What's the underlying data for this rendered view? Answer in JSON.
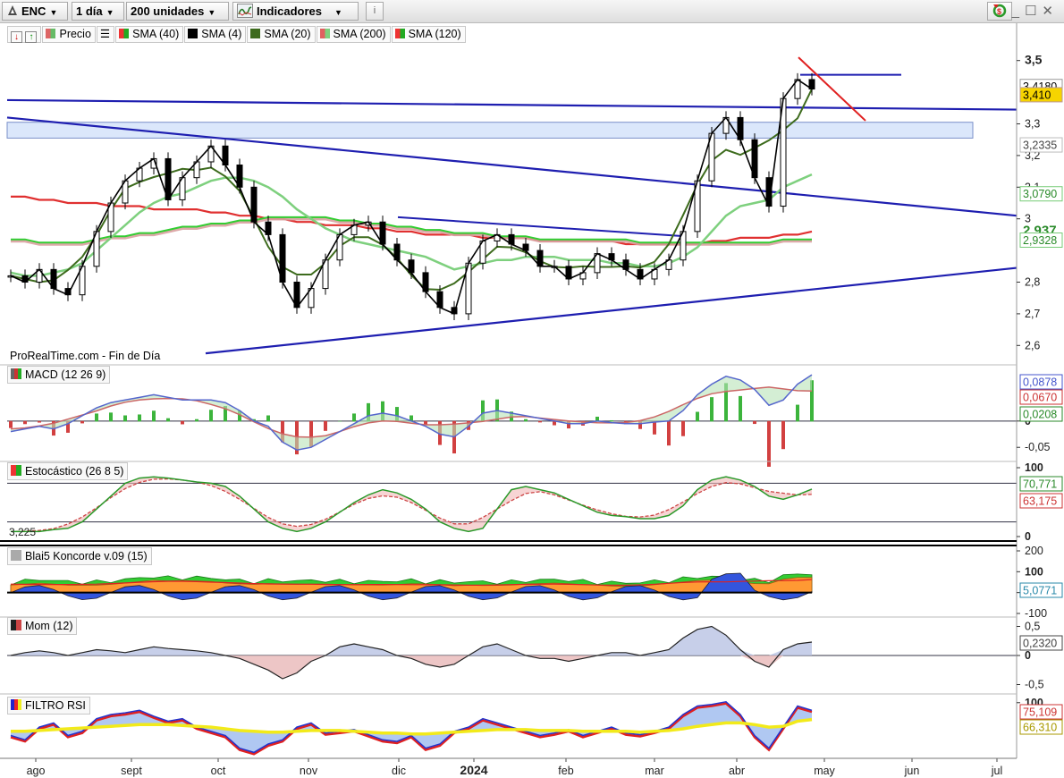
{
  "toolbar": {
    "symbol": "ENC",
    "period": "1 día",
    "units": "200 unidades",
    "indicators": "Indicadores",
    "info_icon": "info-icon",
    "settings_icon": "refresh-icon"
  },
  "legend": {
    "price_label": "Precio",
    "sma_labels": [
      "SMA (40)",
      "SMA (4)",
      "SMA (20)",
      "SMA (200)",
      "SMA (120)"
    ],
    "sma_colors": [
      "#2e9b3a",
      "#000000",
      "#3d6b1d",
      "#d9a0a0",
      "#e03030"
    ]
  },
  "colors": {
    "trendline": "#1e1eb0",
    "resistance": "#e02020",
    "zone": "#dbe7fb",
    "price_badge": "#f6d400",
    "sma200_badge": "#32cd32"
  },
  "source_text": "ProRealTime.com - Fin de Día",
  "chart_data": [
    {
      "type": "line",
      "title": "Precio",
      "x": [
        "ago",
        "sept",
        "oct",
        "nov",
        "dic",
        "2024",
        "feb",
        "mar",
        "abr",
        "may",
        "jun",
        "jul"
      ],
      "ylim": [
        2.55,
        3.55
      ],
      "yticks": [
        "3,5",
        "3,3",
        "3,2",
        "3,1",
        "3",
        "2,8",
        "2,7",
        "2,6"
      ],
      "price_labels": [
        "3,4180",
        "3,410",
        "3,2335",
        "3,0790",
        "2,937",
        "2,9328"
      ],
      "series": [
        {
          "name": "Precio",
          "values": [
            2.82,
            2.8,
            2.84,
            2.78,
            2.76,
            2.85,
            2.96,
            3.05,
            3.12,
            3.16,
            3.19,
            3.06,
            3.13,
            3.18,
            3.23,
            3.17,
            3.1,
            2.99,
            2.95,
            2.8,
            2.72,
            2.78,
            2.87,
            2.95,
            2.98,
            2.99,
            2.92,
            2.87,
            2.83,
            2.77,
            2.72,
            2.7,
            2.86,
            2.93,
            2.95,
            2.92,
            2.9,
            2.85,
            2.85,
            2.81,
            2.83,
            2.89,
            2.87,
            2.84,
            2.81,
            2.84,
            2.87,
            2.96,
            3.12,
            3.27,
            3.32,
            3.25,
            3.13,
            3.04,
            3.38,
            3.44,
            3.41
          ]
        },
        {
          "name": "SMA (40)",
          "values": [
            2.83,
            2.82,
            2.82,
            2.83,
            2.84,
            2.86,
            2.9,
            2.94,
            2.98,
            3.02,
            3.05,
            3.07,
            3.08,
            3.1,
            3.12,
            3.13,
            3.13,
            3.12,
            3.1,
            3.07,
            3.03,
            3.0,
            2.97,
            2.95,
            2.93,
            2.92,
            2.91,
            2.9,
            2.89,
            2.88,
            2.86,
            2.84,
            2.85,
            2.86,
            2.87,
            2.87,
            2.88,
            2.88,
            2.88,
            2.87,
            2.87,
            2.87,
            2.86,
            2.86,
            2.85,
            2.85,
            2.86,
            2.88,
            2.91,
            2.96,
            3.01,
            3.04,
            3.05,
            3.06,
            3.1,
            3.12,
            3.14
          ]
        },
        {
          "name": "SMA (200)",
          "values": [
            2.93,
            2.93,
            2.92,
            2.92,
            2.92,
            2.92,
            2.93,
            2.94,
            2.94,
            2.95,
            2.95,
            2.96,
            2.97,
            2.97,
            2.98,
            2.98,
            2.99,
            2.99,
            3.0,
            3.0,
            3.0,
            3.0,
            3.0,
            2.99,
            2.99,
            2.98,
            2.98,
            2.97,
            2.97,
            2.96,
            2.96,
            2.95,
            2.95,
            2.95,
            2.94,
            2.94,
            2.94,
            2.93,
            2.93,
            2.93,
            2.93,
            2.93,
            2.93,
            2.93,
            2.92,
            2.92,
            2.92,
            2.92,
            2.92,
            2.92,
            2.92,
            2.92,
            2.92,
            2.92,
            2.93,
            2.93,
            2.93
          ]
        },
        {
          "name": "SMA (120)",
          "values": [
            3.07,
            3.07,
            3.06,
            3.06,
            3.05,
            3.05,
            3.05,
            3.04,
            3.04,
            3.04,
            3.03,
            3.03,
            3.03,
            3.03,
            3.02,
            3.02,
            3.01,
            3.01,
            3.0,
            3.0,
            2.99,
            2.99,
            2.98,
            2.98,
            2.98,
            2.97,
            2.97,
            2.96,
            2.96,
            2.95,
            2.95,
            2.95,
            2.95,
            2.94,
            2.94,
            2.94,
            2.94,
            2.93,
            2.93,
            2.93,
            2.93,
            2.93,
            2.93,
            2.92,
            2.92,
            2.92,
            2.92,
            2.92,
            2.92,
            2.93,
            2.93,
            2.94,
            2.94,
            2.94,
            2.95,
            2.95,
            2.96
          ]
        }
      ]
    },
    {
      "type": "area",
      "title": "MACD (12 26 9)",
      "ylim": [
        -0.07,
        0.1
      ],
      "yticks": [
        "0",
        "-0,05"
      ],
      "value_labels": [
        "0,0878",
        "0,0670",
        "0,0208"
      ],
      "series": [
        {
          "name": "MACD",
          "values": [
            -0.02,
            -0.015,
            -0.01,
            -0.015,
            -0.005,
            0.01,
            0.025,
            0.035,
            0.04,
            0.045,
            0.05,
            0.045,
            0.04,
            0.04,
            0.04,
            0.035,
            0.02,
            0.0,
            -0.01,
            -0.04,
            -0.055,
            -0.05,
            -0.035,
            -0.02,
            -0.005,
            0.01,
            0.015,
            0.01,
            0.0,
            -0.01,
            -0.025,
            -0.03,
            -0.01,
            0.015,
            0.02,
            0.015,
            0.01,
            0.005,
            0.0,
            -0.005,
            -0.005,
            0.0,
            -0.003,
            -0.005,
            -0.005,
            -0.002,
            0.0,
            0.02,
            0.05,
            0.07,
            0.085,
            0.078,
            0.06,
            0.03,
            0.04,
            0.07,
            0.088
          ]
        }
      ]
    },
    {
      "type": "line",
      "title": "Estocástico (26 8 5)",
      "ylim": [
        0,
        100
      ],
      "yticks": [
        "100",
        "0"
      ],
      "value_labels": [
        "70,771",
        "63,175",
        "3,225"
      ],
      "series": [
        {
          "name": "Estocástico",
          "values": [
            5,
            5,
            5,
            8,
            10,
            20,
            40,
            60,
            80,
            88,
            90,
            88,
            85,
            82,
            80,
            75,
            60,
            40,
            20,
            10,
            5,
            10,
            20,
            35,
            50,
            62,
            70,
            65,
            55,
            40,
            20,
            10,
            5,
            10,
            40,
            70,
            75,
            70,
            65,
            55,
            45,
            35,
            30,
            28,
            25,
            25,
            30,
            45,
            70,
            85,
            90,
            85,
            75,
            60,
            55,
            62,
            71
          ]
        }
      ]
    },
    {
      "type": "area",
      "title": "Blai5 Koncorde v.09 (15)",
      "ylim": [
        -100,
        200
      ],
      "yticks": [
        "200",
        "100",
        "0",
        "-100"
      ],
      "value_labels": [
        "5,0771"
      ],
      "series": []
    },
    {
      "type": "area",
      "title": "Mom (12)",
      "ylim": [
        -0.6,
        0.6
      ],
      "yticks": [
        "0,5",
        "0",
        "-0,5"
      ],
      "value_labels": [
        "0,2320"
      ],
      "series": [
        {
          "name": "Mom",
          "values": [
            0.0,
            0.05,
            0.08,
            0.05,
            0.0,
            0.05,
            0.1,
            0.08,
            0.05,
            0.1,
            0.15,
            0.12,
            0.1,
            0.08,
            0.05,
            0.0,
            -0.05,
            -0.15,
            -0.25,
            -0.4,
            -0.3,
            -0.1,
            0.0,
            0.15,
            0.2,
            0.15,
            0.1,
            0.0,
            -0.05,
            -0.15,
            -0.2,
            -0.15,
            0.0,
            0.15,
            0.2,
            0.1,
            0.0,
            -0.05,
            -0.05,
            -0.1,
            -0.05,
            0.0,
            0.05,
            0.05,
            0.0,
            0.05,
            0.1,
            0.3,
            0.45,
            0.5,
            0.35,
            0.1,
            -0.1,
            -0.2,
            0.1,
            0.2,
            0.23
          ]
        }
      ]
    },
    {
      "type": "line",
      "title": "FILTRO RSI",
      "ylim": [
        0,
        100
      ],
      "yticks": [
        "100"
      ],
      "value_labels": [
        "75,109",
        "66,310"
      ],
      "series": [
        {
          "name": "RSI",
          "values": [
            45,
            40,
            55,
            60,
            45,
            50,
            65,
            70,
            72,
            75,
            68,
            62,
            65,
            55,
            50,
            45,
            30,
            25,
            35,
            40,
            55,
            60,
            48,
            50,
            52,
            46,
            40,
            38,
            45,
            30,
            35,
            50,
            55,
            65,
            60,
            55,
            50,
            45,
            48,
            52,
            45,
            50,
            55,
            48,
            46,
            50,
            55,
            70,
            80,
            82,
            85,
            70,
            45,
            30,
            55,
            80,
            75
          ]
        },
        {
          "name": "Media",
          "values": [
            52,
            52,
            53,
            54,
            55,
            56,
            57,
            58,
            59,
            60,
            60,
            60,
            59,
            58,
            57,
            55,
            53,
            52,
            51,
            51,
            52,
            53,
            53,
            53,
            52,
            51,
            50,
            50,
            49,
            49,
            50,
            51,
            52,
            53,
            54,
            54,
            54,
            53,
            53,
            53,
            52,
            52,
            52,
            52,
            51,
            52,
            53,
            55,
            58,
            60,
            62,
            62,
            60,
            57,
            58,
            64,
            66
          ]
        }
      ]
    }
  ],
  "x_axis_labels": [
    "ago",
    "sept",
    "oct",
    "nov",
    "dic",
    "2024",
    "feb",
    "mar",
    "abr",
    "may",
    "jun",
    "jul"
  ]
}
